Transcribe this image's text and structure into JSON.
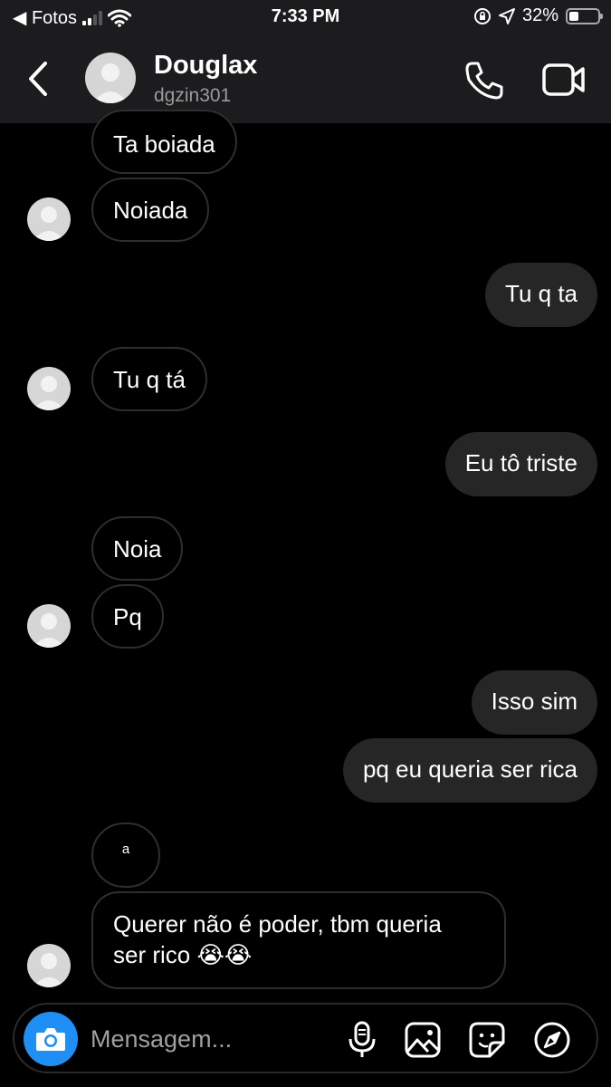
{
  "status": {
    "back_app": "◀ Fotos",
    "time": "7:33 PM",
    "battery": "32%",
    "battery_level": 0.32
  },
  "header": {
    "name": "Douglax",
    "username": "dgzin301"
  },
  "messages": [
    {
      "side": "in",
      "text": "Ta boiada"
    },
    {
      "side": "in",
      "text": "Noiada"
    },
    {
      "side": "out",
      "text": "Tu q ta"
    },
    {
      "side": "in",
      "text": "Tu q tá"
    },
    {
      "side": "out",
      "text": "Eu tô triste"
    },
    {
      "side": "in",
      "text": "Noia"
    },
    {
      "side": "in",
      "text": "Pq"
    },
    {
      "side": "out",
      "text": "Isso sim"
    },
    {
      "side": "out",
      "text": "pq eu queria ser rica"
    },
    {
      "side": "in",
      "text": "a"
    },
    {
      "side": "in",
      "text": "Querer não é poder, tbm queria\nser rico 😭😭"
    }
  ],
  "composer": {
    "placeholder": "Mensagem..."
  },
  "icons": {
    "back": "chevron-left-icon",
    "call": "phone-icon",
    "video": "video-camera-icon",
    "camera": "camera-icon",
    "mic": "microphone-icon",
    "gallery": "image-icon",
    "sticker": "sticker-icon",
    "explore": "compass-icon"
  },
  "colors": {
    "accent": "#1f8ff5",
    "outgoing_bubble": "#262626",
    "header_bg": "#1c1c1e"
  }
}
